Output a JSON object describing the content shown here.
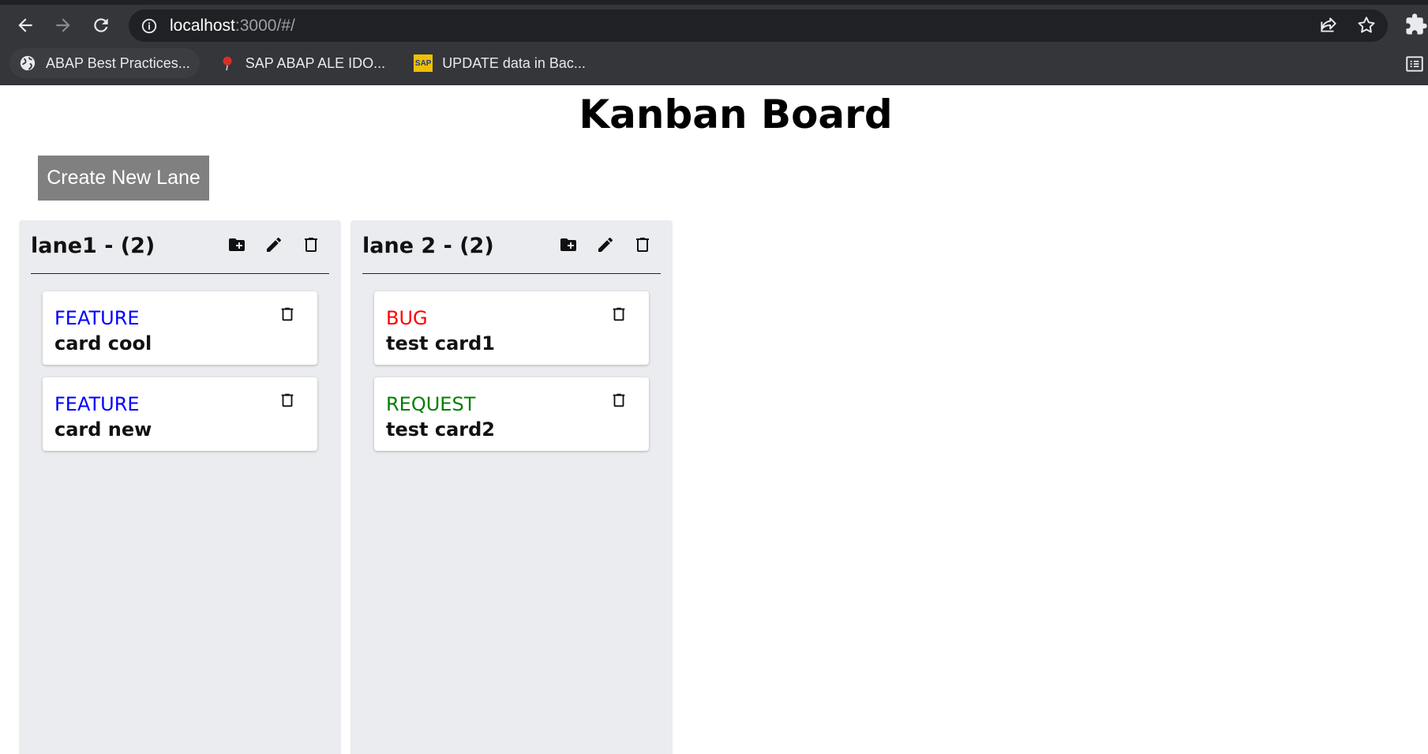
{
  "browser": {
    "url_host": "localhost",
    "url_rest": ":3000/#/",
    "bookmarks": [
      {
        "label": "ABAP Best Practices...",
        "icon": "globe-icon"
      },
      {
        "label": "SAP ABAP ALE IDO...",
        "icon": "pin-icon"
      },
      {
        "label": "UPDATE data in Bac...",
        "icon": "sap-icon",
        "icon_text": "SAP"
      }
    ]
  },
  "page": {
    "title": "Kanban Board",
    "create_button": "Create New Lane"
  },
  "lanes": [
    {
      "title": "lane1 - (2)",
      "cards": [
        {
          "type": "FEATURE",
          "type_color": "#0000ff",
          "title": "card cool"
        },
        {
          "type": "FEATURE",
          "type_color": "#0000ff",
          "title": "card new"
        }
      ]
    },
    {
      "title": "lane 2 - (2)",
      "cards": [
        {
          "type": "BUG",
          "type_color": "#ff0000",
          "title": "test card1"
        },
        {
          "type": "REQUEST",
          "type_color": "#008000",
          "title": "test card2"
        }
      ]
    }
  ],
  "colors": {
    "chrome_bg": "#35363a",
    "omnibox_bg": "#202124",
    "lane_bg": "#ebecf0",
    "button_bg": "#808080"
  }
}
